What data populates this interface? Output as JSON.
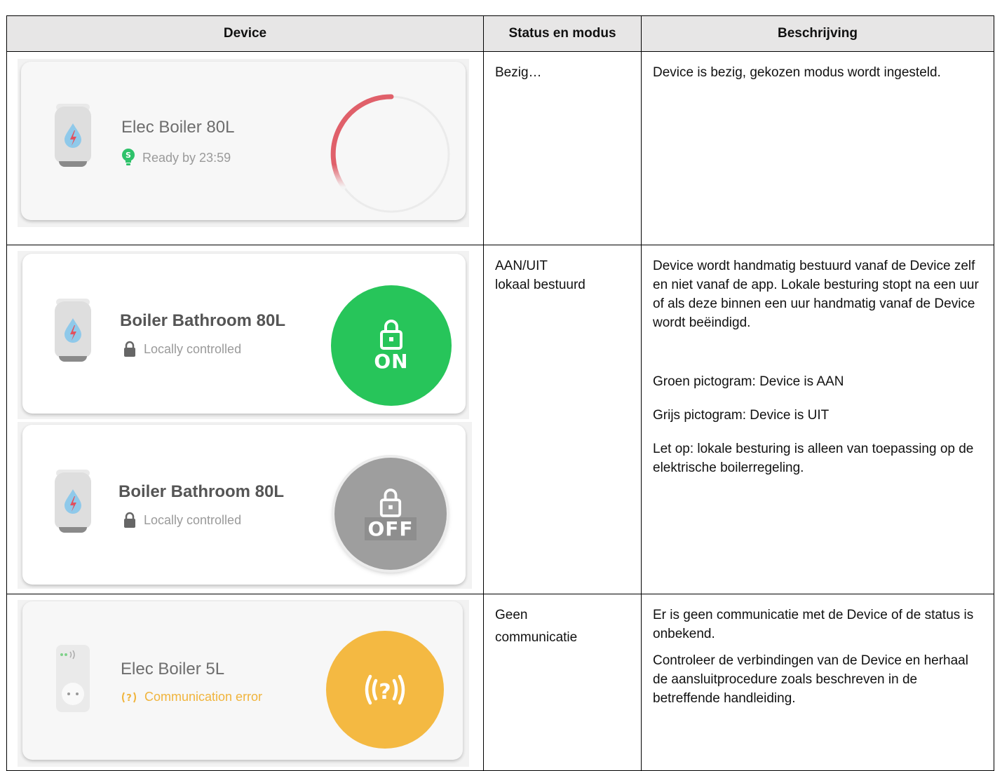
{
  "table": {
    "headers": {
      "device": "Device",
      "status": "Status en modus",
      "description": "Beschrijving"
    }
  },
  "rows": [
    {
      "status_lines": [
        "Bezig…"
      ],
      "description": [
        "Device is bezig, gekozen modus wordt ingesteld."
      ],
      "cards": [
        {
          "name": "Elec Boiler 80L",
          "subtitle": "Ready by 23:59",
          "subtitle_icon": "smart-bulb-icon",
          "button": "progress-ring",
          "accent": "#e0606a"
        }
      ]
    },
    {
      "status_lines": [
        "AAN/UIT",
        "lokaal bestuurd"
      ],
      "description": [
        "Device wordt handmatig bestuurd vanaf de Device zelf en niet vanaf de app. Lokale besturing stopt na een uur of als deze binnen een uur handmatig vanaf de Device wordt beëindigd.",
        "Groen pictogram: Device is AAN",
        "Grijs pictogram: Device is UIT",
        "Let op: lokale besturing is alleen van toepassing op de elektrische boilerregeling."
      ],
      "cards": [
        {
          "name": "Boiler Bathroom 80L",
          "subtitle": "Locally controlled",
          "subtitle_icon": "lock-icon",
          "button_label": "ON",
          "accent": "#27c55a"
        },
        {
          "name": "Boiler Bathroom 80L",
          "subtitle": "Locally controlled",
          "subtitle_icon": "lock-icon",
          "button_label": "OFF",
          "accent": "#9e9e9e"
        }
      ]
    },
    {
      "status_lines": [
        "Geen",
        "communicatie"
      ],
      "description": [
        "Er is geen communicatie met de Device of de status is onbekend.",
        "Controleer de verbindingen van de Device en herhaal de aansluitprocedure zoals beschreven in de betreffende handleiding."
      ],
      "cards": [
        {
          "name": "Elec Boiler 5L",
          "subtitle": "Communication error",
          "subtitle_icon": "signal-question-icon",
          "accent": "#f4b942"
        }
      ]
    }
  ]
}
